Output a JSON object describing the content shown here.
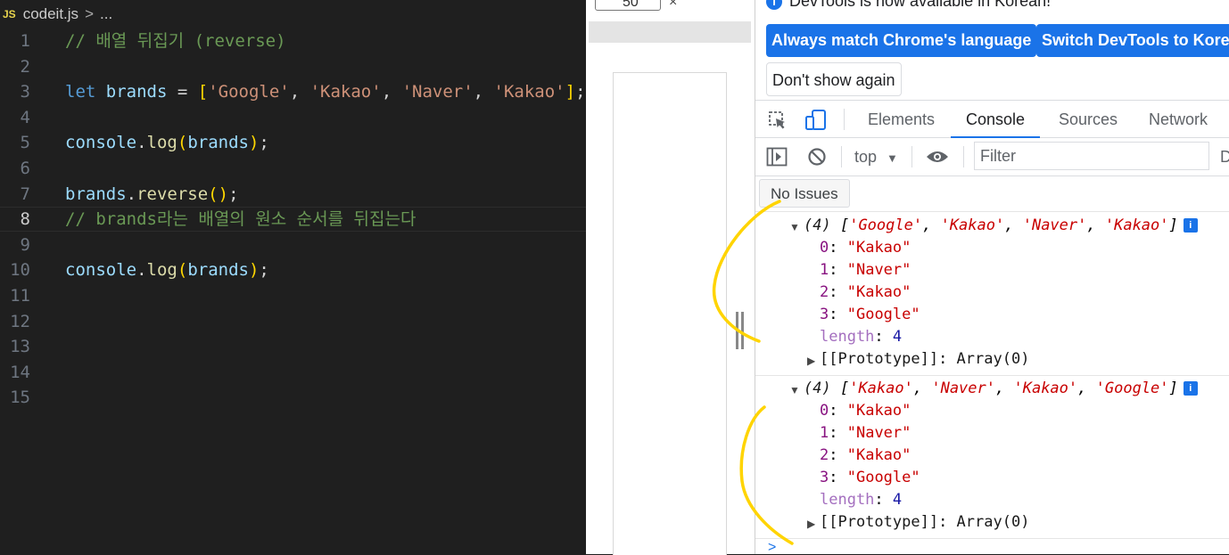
{
  "editor": {
    "file_name": "codeit.js",
    "file_icon": "JS",
    "breadcrumb_sep": ">",
    "breadcrumb_more": "...",
    "lines": [
      {
        "n": "1",
        "tokens": [
          {
            "t": "// 배열 뒤집기 (reverse)",
            "c": "cm"
          }
        ]
      },
      {
        "n": "2",
        "tokens": []
      },
      {
        "n": "3",
        "tokens": [
          {
            "t": "let",
            "c": "kw"
          },
          {
            "t": " ",
            "c": "op"
          },
          {
            "t": "brands",
            "c": "vr"
          },
          {
            "t": " = ",
            "c": "op"
          },
          {
            "t": "[",
            "c": "br"
          },
          {
            "t": "'Google'",
            "c": "st"
          },
          {
            "t": ", ",
            "c": "op"
          },
          {
            "t": "'Kakao'",
            "c": "st"
          },
          {
            "t": ", ",
            "c": "op"
          },
          {
            "t": "'Naver'",
            "c": "st"
          },
          {
            "t": ", ",
            "c": "op"
          },
          {
            "t": "'Kakao'",
            "c": "st"
          },
          {
            "t": "]",
            "c": "br"
          },
          {
            "t": ";",
            "c": "op"
          }
        ]
      },
      {
        "n": "4",
        "tokens": []
      },
      {
        "n": "5",
        "tokens": [
          {
            "t": "console",
            "c": "vr"
          },
          {
            "t": ".",
            "c": "op"
          },
          {
            "t": "log",
            "c": "fn"
          },
          {
            "t": "(",
            "c": "br"
          },
          {
            "t": "brands",
            "c": "vr"
          },
          {
            "t": ")",
            "c": "br"
          },
          {
            "t": ";",
            "c": "op"
          }
        ]
      },
      {
        "n": "6",
        "tokens": []
      },
      {
        "n": "7",
        "tokens": [
          {
            "t": "brands",
            "c": "vr"
          },
          {
            "t": ".",
            "c": "op"
          },
          {
            "t": "reverse",
            "c": "fn"
          },
          {
            "t": "()",
            "c": "br"
          },
          {
            "t": ";",
            "c": "op"
          }
        ]
      },
      {
        "n": "8",
        "tokens": [
          {
            "t": "// brands라는 배열의 원소 순서를 뒤집는다",
            "c": "cm"
          }
        ]
      },
      {
        "n": "9",
        "tokens": []
      },
      {
        "n": "10",
        "tokens": [
          {
            "t": "console",
            "c": "vr"
          },
          {
            "t": ".",
            "c": "op"
          },
          {
            "t": "log",
            "c": "fn"
          },
          {
            "t": "(",
            "c": "br"
          },
          {
            "t": "brands",
            "c": "vr"
          },
          {
            "t": ")",
            "c": "br"
          },
          {
            "t": ";",
            "c": "op"
          }
        ]
      },
      {
        "n": "11",
        "tokens": []
      },
      {
        "n": "12",
        "tokens": []
      },
      {
        "n": "13",
        "tokens": []
      },
      {
        "n": "14",
        "tokens": []
      },
      {
        "n": "15",
        "tokens": []
      }
    ],
    "current_line": "8"
  },
  "viewport": {
    "zoom_value": "50",
    "close_glyph": "×"
  },
  "devtools": {
    "notice": "DevTools is now available in Korean!",
    "notice_icon": "i",
    "btn_match": "Always match Chrome's language",
    "btn_switch": "Switch DevTools to Korean",
    "btn_dont_show": "Don't show again",
    "tabs": [
      {
        "label": "Elements",
        "active": false
      },
      {
        "label": "Console",
        "active": true
      },
      {
        "label": "Sources",
        "active": false
      },
      {
        "label": "Network",
        "active": false
      }
    ],
    "context": "top",
    "filter_placeholder": "Filter",
    "default_levels_cut": "D",
    "issues": "No Issues",
    "logs": [
      {
        "count": "(4)",
        "preview": [
          "'Google'",
          "'Kakao'",
          "'Naver'",
          "'Kakao'"
        ],
        "entries": [
          {
            "key": "0",
            "value": "\"Kakao\""
          },
          {
            "key": "1",
            "value": "\"Naver\""
          },
          {
            "key": "2",
            "value": "\"Kakao\""
          },
          {
            "key": "3",
            "value": "\"Google\""
          }
        ],
        "length_key": "length",
        "length_value": "4",
        "proto_key": "[[Prototype]]",
        "proto_value": "Array(0)"
      },
      {
        "count": "(4)",
        "preview": [
          "'Kakao'",
          "'Naver'",
          "'Kakao'",
          "'Google'"
        ],
        "entries": [
          {
            "key": "0",
            "value": "\"Kakao\""
          },
          {
            "key": "1",
            "value": "\"Naver\""
          },
          {
            "key": "2",
            "value": "\"Kakao\""
          },
          {
            "key": "3",
            "value": "\"Google\""
          }
        ],
        "length_key": "length",
        "length_value": "4",
        "proto_key": "[[Prototype]]",
        "proto_value": "Array(0)"
      }
    ],
    "prompt": ">"
  },
  "colors": {
    "editor_bg": "#1f1f1f",
    "accent": "#1a73e8",
    "annotation": "#ffd400"
  }
}
